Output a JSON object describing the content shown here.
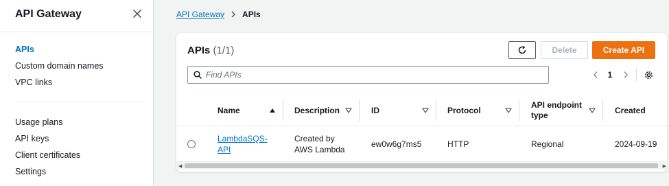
{
  "sidebar": {
    "title": "API Gateway",
    "primary_items": [
      {
        "label": "APIs",
        "active": true
      },
      {
        "label": "Custom domain names"
      },
      {
        "label": "VPC links"
      }
    ],
    "secondary_items": [
      {
        "label": "Usage plans"
      },
      {
        "label": "API keys"
      },
      {
        "label": "Client certificates"
      },
      {
        "label": "Settings"
      }
    ]
  },
  "breadcrumb": {
    "parent": "API Gateway",
    "current": "APIs"
  },
  "panel": {
    "title": "APIs",
    "count": "(1/1)",
    "buttons": {
      "delete_label": "Delete",
      "create_label": "Create API"
    },
    "search_placeholder": "Find APIs",
    "pagination": {
      "current_page": "1"
    }
  },
  "table": {
    "columns": [
      "Name",
      "Description",
      "ID",
      "Protocol",
      "API endpoint type",
      "Created"
    ],
    "rows": [
      {
        "name": "LambdaSQS-API",
        "description": "Created by AWS Lambda",
        "id": "ew0w6g7ms5",
        "protocol": "HTTP",
        "endpoint_type": "Regional",
        "created": "2024-09-19"
      }
    ]
  },
  "colors": {
    "accent": "#0073bb",
    "primary_button": "#ec7211",
    "sidebar_bg": "#ffffff",
    "page_bg": "#f2f3f3"
  }
}
